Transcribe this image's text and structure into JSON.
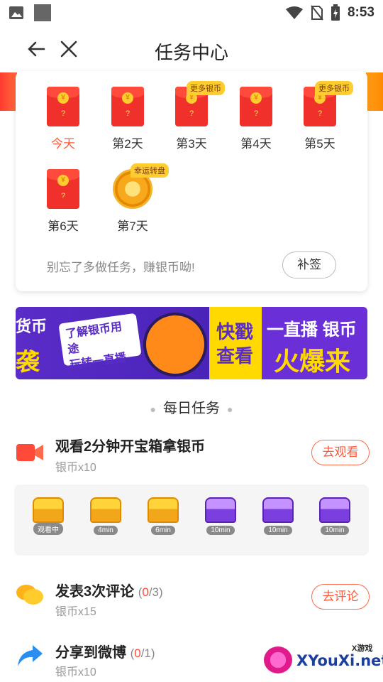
{
  "status_bar": {
    "time": "8:53"
  },
  "header": {
    "title": "任务中心"
  },
  "checkin": {
    "days": [
      {
        "label": "今天",
        "type": "envelope",
        "badge": ""
      },
      {
        "label": "第2天",
        "type": "envelope",
        "badge": ""
      },
      {
        "label": "第3天",
        "type": "envelope",
        "badge": "更多银币"
      },
      {
        "label": "第4天",
        "type": "envelope",
        "badge": ""
      },
      {
        "label": "第5天",
        "type": "envelope",
        "badge": "更多银币"
      },
      {
        "label": "第6天",
        "type": "envelope",
        "badge": ""
      },
      {
        "label": "第7天",
        "type": "wheel",
        "badge": "幸运转盘"
      }
    ],
    "envelope_mark": "?",
    "hint": "别忘了多做任务，赚银币呦!",
    "makeup_button": "补签"
  },
  "banner": {
    "left_top": "货币",
    "left_bottom": "袭",
    "pill_line1": "了解银币用途",
    "pill_line2": "玩转一直播",
    "yellow_line1": "快戳",
    "yellow_line2": "查看",
    "right_top": "一直播 银币",
    "right_bottom": "火爆来"
  },
  "daily": {
    "title": "每日任务",
    "tasks": [
      {
        "name": "观看2分钟开宝箱拿银币",
        "progress_cur": "",
        "progress_total": "",
        "reward": "银币x10",
        "button": "去观看"
      },
      {
        "name": "发表3次评论",
        "progress_cur": "0",
        "progress_total": "/3)",
        "reward": "银币x15",
        "button": "去评论"
      },
      {
        "name": "分享到微博",
        "progress_cur": "0",
        "progress_total": "/1)",
        "reward": "银币x10",
        "button": ""
      }
    ],
    "chests": [
      "观看中",
      "4min",
      "6min",
      "10min",
      "10min",
      "10min"
    ]
  },
  "watermark": {
    "small": "X游戏",
    "text": "XYouXi.net"
  },
  "colors": {
    "accent": "#ff5a3a",
    "envelope": "#f0302a",
    "coin": "#ffcc2e",
    "banner_purple": "#5a2cc8",
    "banner_yellow": "#ffd900"
  },
  "icons": [
    "image-icon",
    "square-icon",
    "wifi-icon",
    "no-sim-icon",
    "battery-charging-icon",
    "back-arrow-icon",
    "close-icon",
    "video-camera-icon",
    "chat-bubbles-icon",
    "share-arrow-icon"
  ]
}
